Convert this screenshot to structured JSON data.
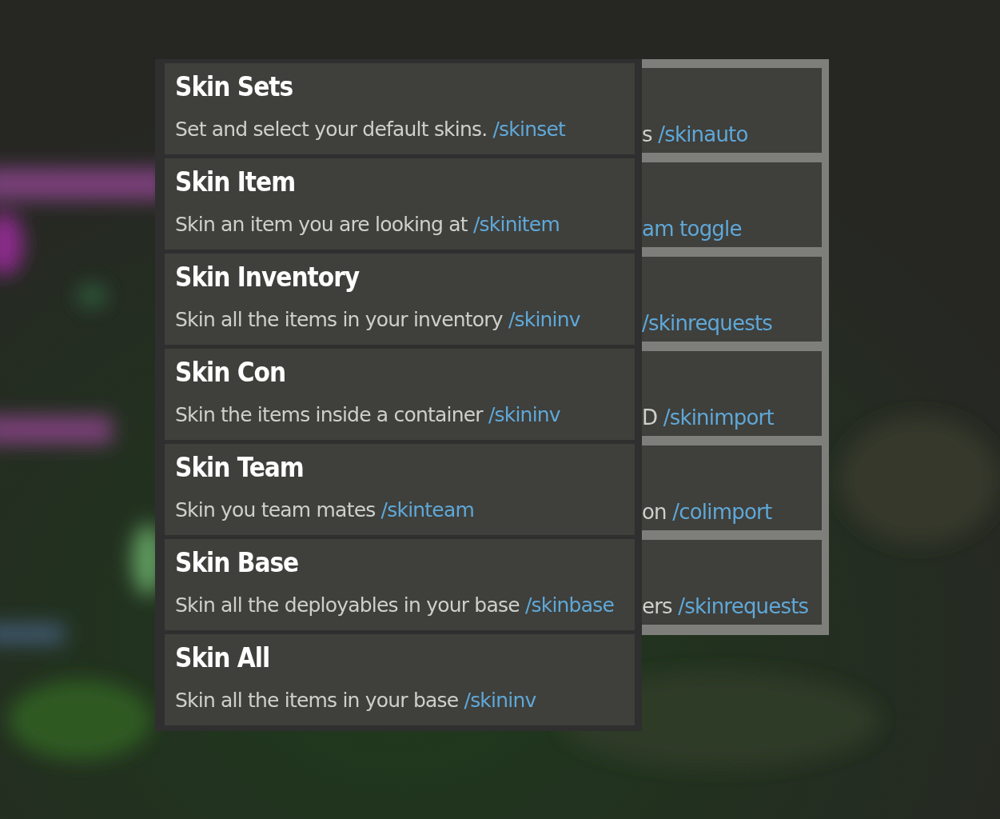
{
  "commands": [
    {
      "title": "Skin Sets",
      "description": "Set and select your default skins.",
      "command": "/skinset"
    },
    {
      "title": "Skin Item",
      "description": "Skin an item you are looking at",
      "command": "/skinitem"
    },
    {
      "title": "Skin Inventory",
      "description": "Skin all the items in your inventory",
      "command": "/skininv"
    },
    {
      "title": "Skin Con",
      "description": "Skin the items inside a container",
      "command": "/skininv"
    },
    {
      "title": "Skin Team",
      "description": "Skin you team mates",
      "command": "/skinteam"
    },
    {
      "title": "Skin Base",
      "description": "Skin all the deployables in your base",
      "command": "/skinbase"
    },
    {
      "title": "Skin All",
      "description": "Skin all the items in your base",
      "command": "/skininv"
    }
  ],
  "back_commands": [
    {
      "description": "s",
      "command": "/skinauto"
    },
    {
      "command": "am toggle"
    },
    {
      "command": "/skinrequests"
    },
    {
      "description": "D",
      "command": "/skinimport"
    },
    {
      "description": "on",
      "command": "/colimport"
    },
    {
      "description": "ers",
      "command": "/skinrequests"
    }
  ]
}
